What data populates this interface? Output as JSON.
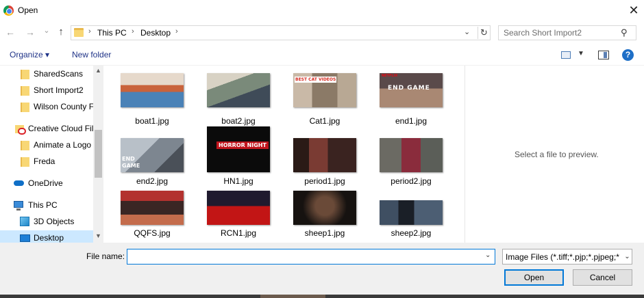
{
  "window": {
    "title": "Open",
    "app_icon": "chrome-icon",
    "close_glyph": "✕"
  },
  "nav": {
    "back_glyph": "←",
    "forward_glyph": "→",
    "recent_glyph": "⌄",
    "up_glyph": "↑",
    "breadcrumb": [
      "This PC",
      "Desktop"
    ],
    "separator_glyph": "›",
    "dropdown_glyph": "⌄",
    "refresh_glyph": "↻",
    "search_placeholder": "Search Short Import2",
    "search_glyph": "⚲"
  },
  "toolbar": {
    "organize_label": "Organize ▾",
    "new_folder_label": "New folder",
    "view_dropdown_glyph": "▼",
    "help_glyph": "?"
  },
  "sidebar": {
    "items": [
      {
        "label": "SharedScans",
        "icon": "folder-icon"
      },
      {
        "label": "Short Import2",
        "icon": "folder-icon"
      },
      {
        "label": "Wilson County F",
        "icon": "folder-icon"
      },
      {
        "label": "Creative Cloud Fil",
        "icon": "creative-cloud-icon"
      },
      {
        "label": "Animate a Logo",
        "icon": "folder-icon"
      },
      {
        "label": "Freda",
        "icon": "folder-icon"
      },
      {
        "label": "OneDrive",
        "icon": "onedrive-icon"
      },
      {
        "label": "This PC",
        "icon": "pc-icon"
      },
      {
        "label": "3D Objects",
        "icon": "3d-objects-icon"
      },
      {
        "label": "Desktop",
        "icon": "desktop-icon",
        "selected": true
      }
    ],
    "scroll_up_glyph": "▲",
    "scroll_down_glyph": "▼"
  },
  "files": [
    {
      "name": "boat1.jpg",
      "overlay": ""
    },
    {
      "name": "boat2.jpg",
      "overlay": ""
    },
    {
      "name": "Cat1.jpg",
      "overlay": "BEST CAT VIDEOS"
    },
    {
      "name": "end1.jpg",
      "overlay": "END GAME",
      "badge": "NETFLIX"
    },
    {
      "name": "end2.jpg",
      "overlay": "END GAME"
    },
    {
      "name": "HN1.jpg",
      "overlay": "HORROR NIGHT"
    },
    {
      "name": "period1.jpg",
      "overlay": ""
    },
    {
      "name": "period2.jpg",
      "overlay": ""
    },
    {
      "name": "QQFS.jpg",
      "overlay": ""
    },
    {
      "name": "RCN1.jpg",
      "overlay": ""
    },
    {
      "name": "sheep1.jpg",
      "overlay": ""
    },
    {
      "name": "sheep2.jpg",
      "overlay": ""
    }
  ],
  "preview": {
    "message": "Select a file to preview."
  },
  "footer": {
    "file_name_label": "File name:",
    "file_name_value": "",
    "file_name_dropdown_glyph": "⌄",
    "filter_value": "Image Files (*.tiff;*.pjp;*.pjpeg;*",
    "filter_dropdown_glyph": "⌄",
    "open_label": "Open",
    "cancel_label": "Cancel"
  },
  "colors": {
    "accent": "#0078d7",
    "selection": "#cce8ff",
    "link": "#1e3287",
    "footer_bg": "#f0f0f0"
  }
}
